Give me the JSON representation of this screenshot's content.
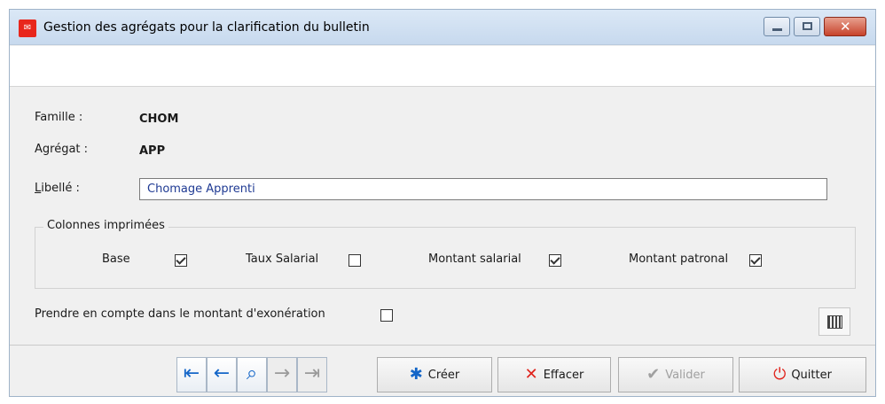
{
  "window": {
    "title": "Gestion des agrégats pour la clarification du bulletin",
    "icon": "app-red-icon"
  },
  "form": {
    "famille": {
      "label": "Famille :",
      "value": "CHOM"
    },
    "agregat": {
      "label": "Agrégat :",
      "value": "APP"
    },
    "libelle": {
      "label": "Libellé :",
      "value": "Chomage Apprenti"
    }
  },
  "colonnes": {
    "legend": "Colonnes imprimées",
    "items": [
      {
        "label": "Base",
        "checked": true
      },
      {
        "label": "Taux Salarial",
        "checked": false
      },
      {
        "label": "Montant salarial",
        "checked": true
      },
      {
        "label": "Montant patronal",
        "checked": true
      }
    ]
  },
  "exoneration": {
    "label": "Prendre en compte dans le montant d'exonération",
    "checked": false
  },
  "toolbar": {
    "nav": [
      {
        "name": "first",
        "icon": "first-record-icon",
        "enabled": true
      },
      {
        "name": "previous",
        "icon": "previous-record-icon",
        "enabled": true
      },
      {
        "name": "search",
        "icon": "search-icon",
        "enabled": true
      },
      {
        "name": "next",
        "icon": "next-record-icon",
        "enabled": false
      },
      {
        "name": "last",
        "icon": "last-record-icon",
        "enabled": false
      }
    ],
    "create": {
      "label": "Créer",
      "icon": "snowflake-icon"
    },
    "delete": {
      "label": "Effacer",
      "icon": "cross-icon"
    },
    "validate": {
      "label": "Valider",
      "icon": "checkmark-icon",
      "enabled": false
    },
    "quit": {
      "label": "Quitter",
      "icon": "power-icon"
    }
  }
}
